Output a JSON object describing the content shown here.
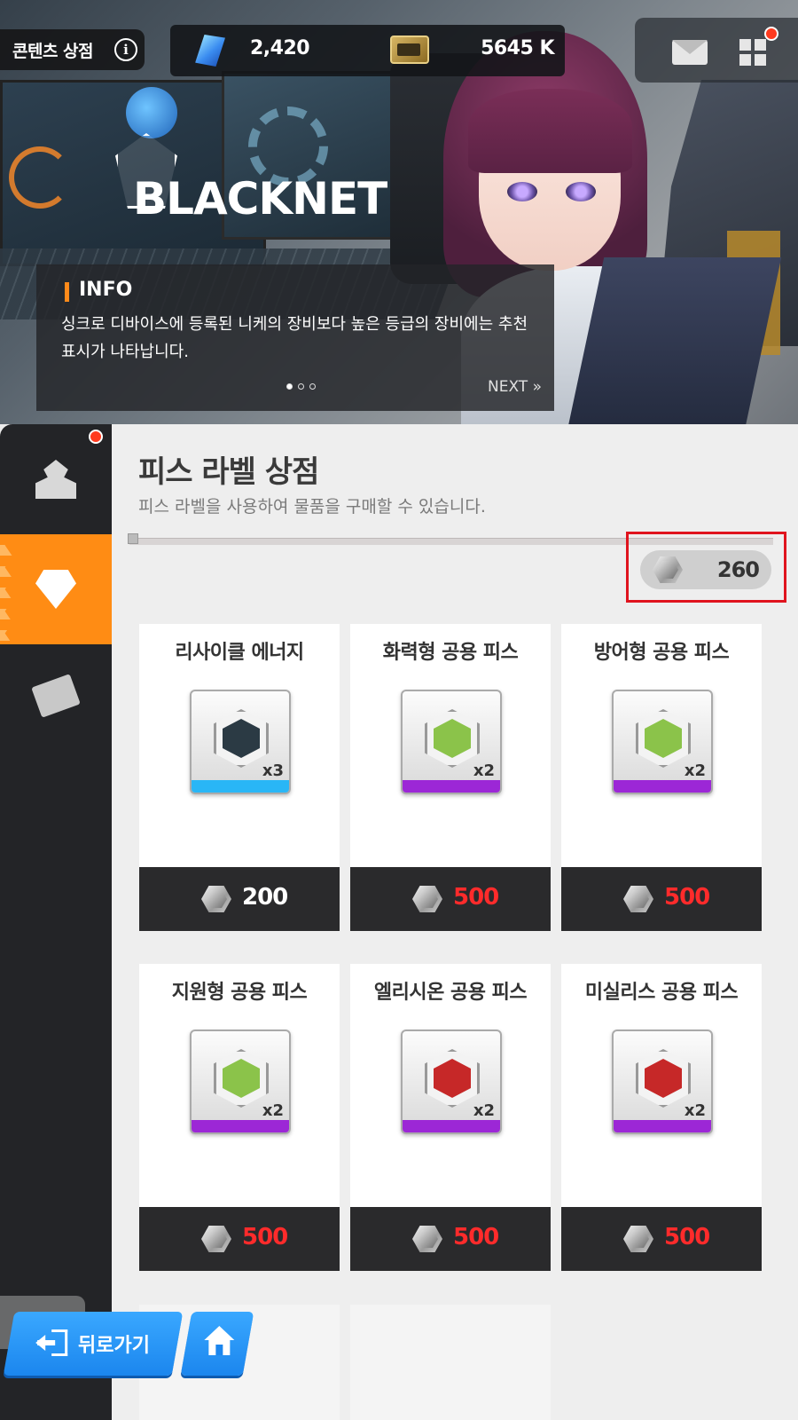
{
  "header": {
    "title": "콘텐츠 상점",
    "info_icon": "info-icon",
    "gems": "2,420",
    "credits": "5645 K",
    "mail_icon": "mail-icon",
    "menu_icon": "grid-menu-icon"
  },
  "banner": {
    "logo_text": "BLACKNET",
    "info_label": "INFO",
    "info_text": "싱크로 디바이스에 등록된 니케의 장비보다 높은 등급의 장비에는 추천 표시가 나타납니다.",
    "next_label": "NEXT »",
    "page_dots": 3,
    "active_dot": 1
  },
  "sidebar": {
    "items": [
      {
        "icon": "anvil-icon",
        "active": false,
        "badge": true
      },
      {
        "icon": "diamond-icon",
        "active": true,
        "badge": false
      },
      {
        "icon": "ticket-icon",
        "active": false,
        "badge": false
      }
    ]
  },
  "shop": {
    "title": "피스 라벨 상점",
    "description": "피스 라벨을 사용하여 물품을 구매할 수 있습니다.",
    "balance": "260",
    "items": [
      {
        "name": "리사이클 에너지",
        "qty": "x3",
        "price": "200",
        "price_color": "#ffffff",
        "stripe": "#29b6f6",
        "core": "#2b3a44"
      },
      {
        "name": "화력형 공용 피스",
        "qty": "x2",
        "price": "500",
        "price_color": "#ff2b2b",
        "stripe": "#9c27d6",
        "core": "#8bc34a"
      },
      {
        "name": "방어형 공용 피스",
        "qty": "x2",
        "price": "500",
        "price_color": "#ff2b2b",
        "stripe": "#9c27d6",
        "core": "#8bc34a"
      },
      {
        "name": "지원형 공용 피스",
        "qty": "x2",
        "price": "500",
        "price_color": "#ff2b2b",
        "stripe": "#9c27d6",
        "core": "#8bc34a"
      },
      {
        "name": "엘리시온 공용 피스",
        "qty": "x2",
        "price": "500",
        "price_color": "#ff2b2b",
        "stripe": "#9c27d6",
        "core": "#c62828"
      },
      {
        "name": "미실리스 공용 피스",
        "qty": "x2",
        "price": "500",
        "price_color": "#ff2b2b",
        "stripe": "#9c27d6",
        "core": "#c62828"
      }
    ]
  },
  "footer": {
    "back_label": "뒤로가기",
    "home_icon": "home-icon"
  },
  "colors": {
    "accent": "#ff8c14",
    "button_blue": "#1b86ee",
    "price_red": "#ff2b2b",
    "highlight": "#e0141e"
  }
}
